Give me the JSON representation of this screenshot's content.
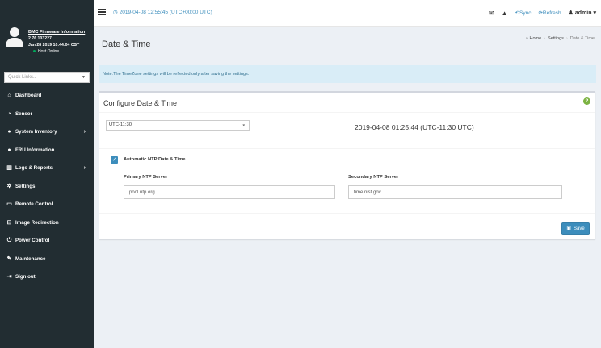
{
  "sidebar": {
    "fw_title": "BMC Firmware Information",
    "fw_version": "2.76.103227",
    "fw_date": "Jan 28 2019 10:44:04 CST",
    "host_status": "Host Online",
    "quick_links_placeholder": "Quick Links..",
    "menu": [
      {
        "label": "Dashboard",
        "icon": "dashboard-icon"
      },
      {
        "label": "Sensor",
        "icon": "tachometer-icon"
      },
      {
        "label": "System Inventory",
        "icon": "info-icon"
      },
      {
        "label": "FRU Information",
        "icon": "info-icon"
      },
      {
        "label": "Logs & Reports",
        "icon": "bar-chart-icon"
      },
      {
        "label": "Settings",
        "icon": "gear-icon"
      },
      {
        "label": "Remote Control",
        "icon": "monitor-icon"
      },
      {
        "label": "Image Redirection",
        "icon": "disk-icon"
      },
      {
        "label": "Power Control",
        "icon": "power-icon"
      },
      {
        "label": "Maintenance",
        "icon": "wrench-icon"
      },
      {
        "label": "Sign out",
        "icon": "sign-out-icon"
      }
    ]
  },
  "header": {
    "datetime": "2019-04-08 12:55:45 (UTC+00:00 UTC)",
    "sync_label": "Sync",
    "refresh_label": "Refresh",
    "user_label": "admin"
  },
  "page": {
    "title": "Date & Time",
    "breadcrumb": {
      "home": "Home",
      "settings": "Settings",
      "current": "Date & Time"
    },
    "note": "Note:The TimeZone settings will be reflected only after saving the settings."
  },
  "config": {
    "title": "Configure Date & Time",
    "timezone_value": "UTC-11:30",
    "current_datetime": "2019-04-08 01:25:44 (UTC-11:30 UTC)",
    "ntp_checkbox_label": "Automatic NTP Date & Time",
    "ntp_checked": true,
    "primary_label": "Primary NTP Server",
    "primary_value": "pool.ntp.org",
    "secondary_label": "Secondary NTP Server",
    "secondary_value": "time.nist.gov",
    "save_label": "Save"
  },
  "colors": {
    "sidebar_bg": "#222d32",
    "accent": "#3c8dbc",
    "note_bg": "#d9edf7",
    "status_online": "#00a65a",
    "help_green": "#7cb342"
  }
}
